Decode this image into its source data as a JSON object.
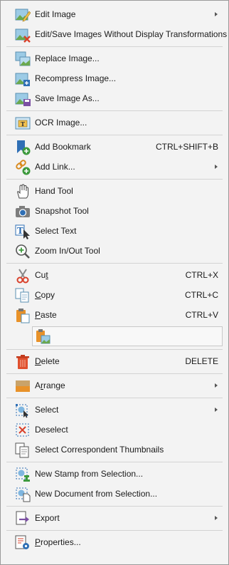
{
  "menu": {
    "items": [
      {
        "id": "edit-image",
        "label": "Edit Image",
        "shortcut": "",
        "submenu": true,
        "icon": "edit-image-icon"
      },
      {
        "id": "edit-save-images",
        "label": "Edit/Save Images Without Display Transformations",
        "shortcut": "",
        "submenu": false,
        "icon": "edit-save-image-icon"
      },
      {
        "id": "replace-image",
        "label": "Replace Image...",
        "shortcut": "",
        "submenu": false,
        "icon": "replace-image-icon"
      },
      {
        "id": "recompress-image",
        "label": "Recompress Image...",
        "shortcut": "",
        "submenu": false,
        "icon": "recompress-image-icon"
      },
      {
        "id": "save-image-as",
        "label": "Save Image As...",
        "shortcut": "",
        "submenu": false,
        "icon": "save-image-icon"
      },
      {
        "id": "ocr-image",
        "label": "OCR Image...",
        "shortcut": "",
        "submenu": false,
        "icon": "ocr-image-icon"
      },
      {
        "id": "add-bookmark",
        "label": "Add Bookmark",
        "shortcut": "CTRL+SHIFT+B",
        "submenu": false,
        "icon": "bookmark-icon"
      },
      {
        "id": "add-link",
        "label": "Add Link...",
        "shortcut": "",
        "submenu": true,
        "icon": "link-icon"
      },
      {
        "id": "hand-tool",
        "label": "Hand Tool",
        "shortcut": "",
        "submenu": false,
        "icon": "hand-icon"
      },
      {
        "id": "snapshot-tool",
        "label": "Snapshot Tool",
        "shortcut": "",
        "submenu": false,
        "icon": "camera-icon"
      },
      {
        "id": "select-text",
        "label": "Select Text",
        "shortcut": "",
        "submenu": false,
        "icon": "select-text-icon"
      },
      {
        "id": "zoom-tool",
        "label": "Zoom In/Out Tool",
        "shortcut": "",
        "submenu": false,
        "icon": "zoom-icon"
      },
      {
        "id": "cut",
        "label_pre": "Cu",
        "label_ul": "t",
        "label_post": "",
        "shortcut": "CTRL+X",
        "submenu": false,
        "icon": "scissors-icon"
      },
      {
        "id": "copy",
        "label_pre": "",
        "label_ul": "C",
        "label_post": "opy",
        "shortcut": "CTRL+C",
        "submenu": false,
        "icon": "copy-icon"
      },
      {
        "id": "paste",
        "label_pre": "",
        "label_ul": "P",
        "label_post": "aste",
        "shortcut": "CTRL+V",
        "submenu": false,
        "icon": "paste-icon"
      },
      {
        "id": "delete",
        "label_pre": "",
        "label_ul": "D",
        "label_post": "elete",
        "shortcut": "DELETE",
        "submenu": false,
        "icon": "trash-icon"
      },
      {
        "id": "arrange",
        "label_pre": "A",
        "label_ul": "r",
        "label_post": "range",
        "shortcut": "",
        "submenu": true,
        "icon": "arrange-icon"
      },
      {
        "id": "select",
        "label": "Select",
        "shortcut": "",
        "submenu": true,
        "icon": "select-icon"
      },
      {
        "id": "deselect",
        "label": "Deselect",
        "shortcut": "",
        "submenu": false,
        "icon": "deselect-icon"
      },
      {
        "id": "select-thumbnails",
        "label": "Select Correspondent Thumbnails",
        "shortcut": "",
        "submenu": false,
        "icon": "thumbnails-icon"
      },
      {
        "id": "new-stamp",
        "label": "New Stamp from Selection...",
        "shortcut": "",
        "submenu": false,
        "icon": "stamp-icon"
      },
      {
        "id": "new-document",
        "label": "New Document from Selection...",
        "shortcut": "",
        "submenu": false,
        "icon": "new-document-icon"
      },
      {
        "id": "export",
        "label": "Export",
        "shortcut": "",
        "submenu": true,
        "icon": "export-icon"
      },
      {
        "id": "properties",
        "label_pre": "",
        "label_ul": "P",
        "label_post": "roperties...",
        "shortcut": "",
        "submenu": false,
        "icon": "properties-icon"
      }
    ]
  },
  "colors": {
    "background": "#f3f3f3",
    "separator": "#d3d3d3",
    "text": "#1a1a1a",
    "accent_blue": "#2f6fb5",
    "accent_green": "#3d9a3d",
    "accent_red": "#d9412b",
    "accent_orange": "#e8922a"
  }
}
